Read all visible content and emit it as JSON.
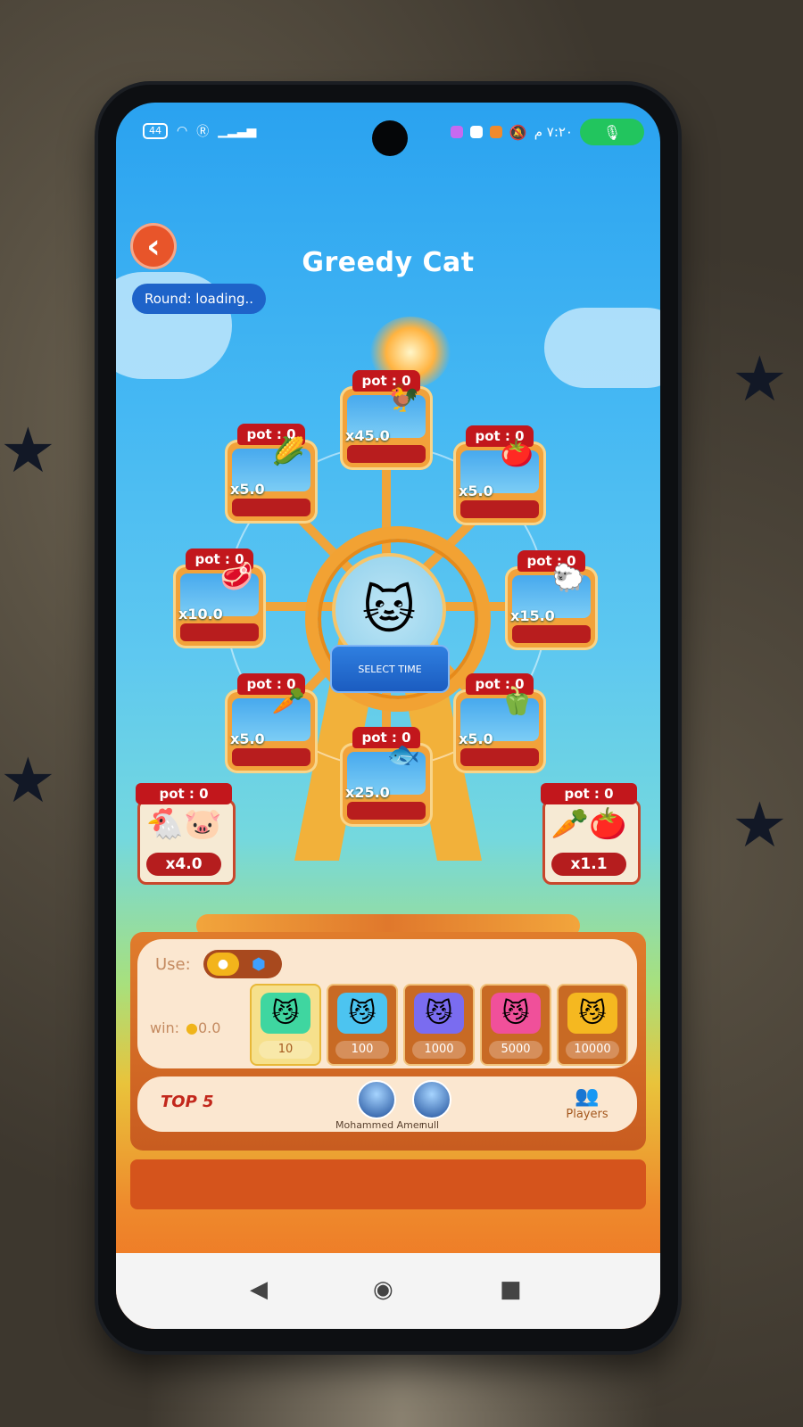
{
  "status_bar": {
    "battery": "44",
    "network_icons": [
      "wifi-icon",
      "r-icon",
      "signal-icon"
    ],
    "time": "٧:٢٠ م",
    "app_icons": [
      "app-icon",
      "chrome-icon",
      "orange-app-icon",
      "mute-icon"
    ],
    "mic_color": "#22c55e"
  },
  "header": {
    "title": "Greedy Cat",
    "back_icon": "chevron-left-icon",
    "round_label": "Round: loading.."
  },
  "wheel": {
    "center_button": "SELECT TIME",
    "cabins": [
      {
        "pot": "pot : 0",
        "multiplier": "x45.0",
        "icon": "rooster-icon"
      },
      {
        "pot": "pot : 0",
        "multiplier": "x5.0",
        "icon": "tomato-icon"
      },
      {
        "pot": "pot : 0",
        "multiplier": "x15.0",
        "icon": "sheep-icon"
      },
      {
        "pot": "pot : 0",
        "multiplier": "x5.0",
        "icon": "pepper-icon"
      },
      {
        "pot": "pot : 0",
        "multiplier": "x25.0",
        "icon": "fish-icon"
      },
      {
        "pot": "pot : 0",
        "multiplier": "x5.0",
        "icon": "carrot-icon"
      },
      {
        "pot": "pot : 0",
        "multiplier": "x10.0",
        "icon": "meat-icon"
      },
      {
        "pot": "pot : 0",
        "multiplier": "x5.0",
        "icon": "corn-icon"
      }
    ],
    "side_left": {
      "pot": "pot : 0",
      "multiplier": "x4.0",
      "icon": "animals-icon"
    },
    "side_right": {
      "pot": "pot : 0",
      "multiplier": "x1.1",
      "icon": "vegetables-icon"
    }
  },
  "bet_panel": {
    "use_label": "Use:",
    "win_label": "win:",
    "win_value": "0.0",
    "chips": [
      {
        "value": "10",
        "color": "#3fd6a0",
        "selected": true
      },
      {
        "value": "100",
        "color": "#4cc4f0",
        "selected": false
      },
      {
        "value": "1000",
        "color": "#7a6cf0",
        "selected": false
      },
      {
        "value": "5000",
        "color": "#f0509a",
        "selected": false
      },
      {
        "value": "10000",
        "color": "#f5b820",
        "selected": false
      }
    ]
  },
  "top5": {
    "label": "TOP 5",
    "players": [
      {
        "name": "Mohammed Amer"
      },
      {
        "name": "null"
      }
    ],
    "players_button": "Players"
  }
}
